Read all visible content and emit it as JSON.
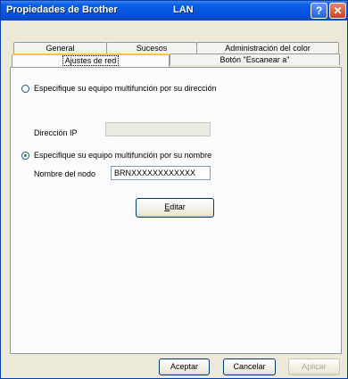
{
  "window": {
    "title": "Propiedades de Brother",
    "title_suffix": "LAN",
    "help_glyph": "?",
    "close_glyph": "✕"
  },
  "tabs_back": [
    {
      "label": "General"
    },
    {
      "label": "Sucesos"
    },
    {
      "label": "Administración del color"
    }
  ],
  "tabs_front": [
    {
      "label": "Ajustes de red",
      "active": true
    },
    {
      "label": "Botón \"Escanear a\"",
      "active": false
    }
  ],
  "address_option": {
    "label": "Especifique su equipo multifunción por su dirección",
    "selected": false,
    "ip_label": "Dirección IP",
    "ip_value": ""
  },
  "name_option": {
    "label": "Especifique su equipo multifunción por su nombre",
    "selected": true,
    "node_label": "Nombre del nodo",
    "node_value": "BRNXXXXXXXXXXXX"
  },
  "edit_button": {
    "prefix": "",
    "accel": "E",
    "rest": "ditar"
  },
  "footer": {
    "ok_label": "Aceptar",
    "cancel_label": "Cancelar",
    "apply_label": "Aplicar"
  }
}
